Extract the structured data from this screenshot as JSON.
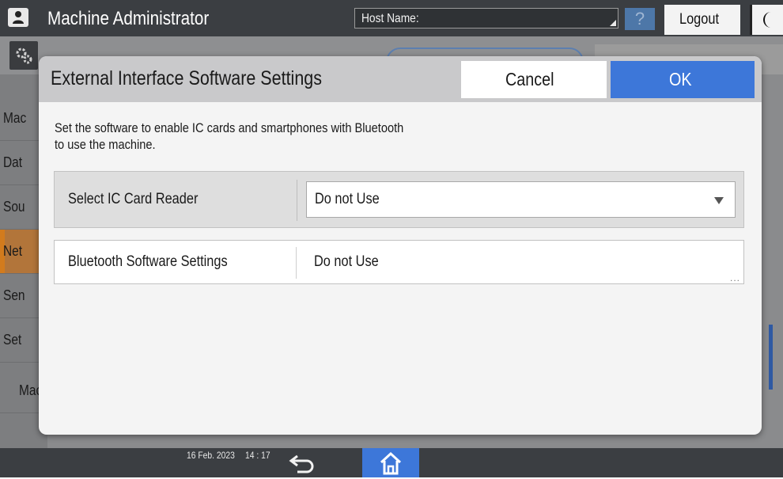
{
  "header": {
    "title": "Machine Administrator",
    "host_label": "Host Name:",
    "help_label": "?",
    "logout_label": "Logout"
  },
  "sidebar": {
    "items": [
      {
        "label": "Mac"
      },
      {
        "label": "Dat"
      },
      {
        "label": "Sou"
      },
      {
        "label": "Net"
      },
      {
        "label": "Sen"
      },
      {
        "label": "Set"
      },
      {
        "label": "Mac\nInfo"
      }
    ]
  },
  "dialog": {
    "title": "External Interface Software Settings",
    "cancel_label": "Cancel",
    "ok_label": "OK",
    "description": "Set the software to enable IC cards and smartphones with Bluetooth\nto use the machine.",
    "rows": [
      {
        "label": "Select IC Card Reader",
        "value": "Do not Use"
      },
      {
        "label": "Bluetooth Software Settings",
        "value": "Do not Use",
        "more": "..."
      }
    ]
  },
  "footer": {
    "date": "16 Feb. 2023",
    "time": "14 : 17"
  },
  "colors": {
    "accent": "#3d77d9",
    "header_bg": "#3b3e42",
    "active_tab": "#d27b1d"
  },
  "icons": [
    "user-icon",
    "gear-icon",
    "help-icon",
    "moon-icon",
    "back-arrow-icon",
    "home-icon",
    "dropdown-arrow-icon",
    "more-icon"
  ]
}
